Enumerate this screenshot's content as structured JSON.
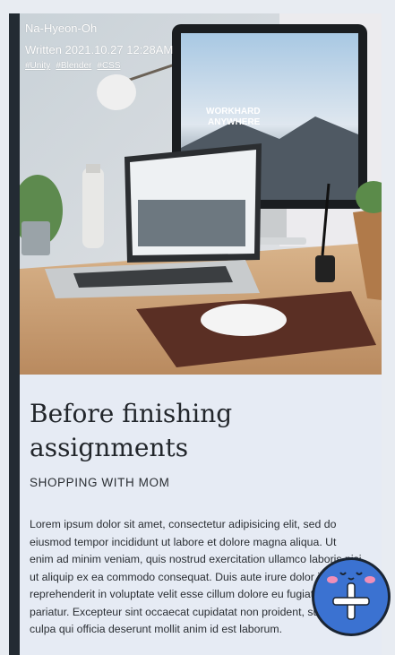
{
  "post": {
    "author": "Na-Hyeon-Oh",
    "written": "Written 2021.10.27 12:28AM",
    "tags": [
      "#Unity",
      "#Blender",
      "#CSS"
    ],
    "title": "Before finishing assignments",
    "subtitle": "SHOPPING WITH MOM",
    "body": "Lorem ipsum dolor sit amet, consectetur adipisicing elit, sed do eiusmod tempor incididunt ut labore et dolore magna aliqua. Ut enim ad minim veniam, quis nostrud exercitation ullamco laboris nisi ut aliquip ex ea commodo consequat. Duis aute irure dolor in reprehenderit in voluptate velit esse cillum dolore eu fugiat nulla pariatur. Excepteur sint occaecat cupidatat non proident, sunt in culpa qui officia deserunt mollit anim id est laborum."
  },
  "hero_screen_text": [
    "WORKHARD",
    "ANYWHERE"
  ],
  "colors": {
    "accent": "#3b72d1",
    "sidebar": "#232b33",
    "card_bg": "#e6ebf4"
  },
  "icons": [
    "plus-icon",
    "face-icon"
  ]
}
